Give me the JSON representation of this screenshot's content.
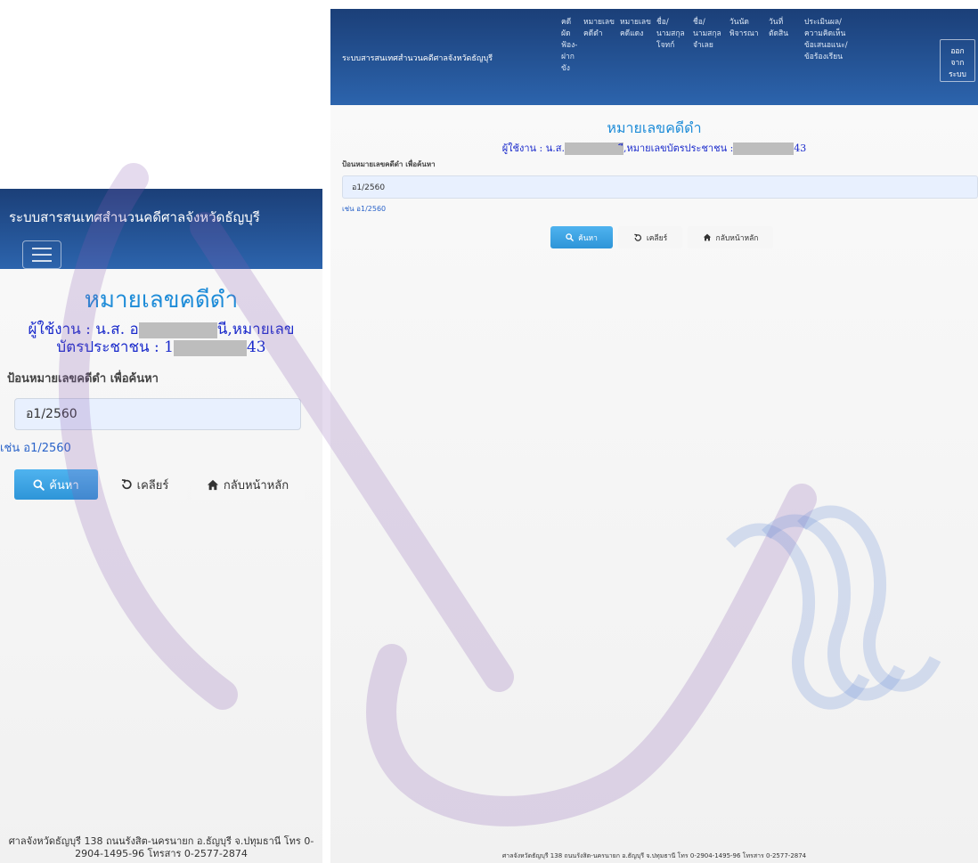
{
  "app": {
    "brand": "ระบบสารสนเทศสำนวนคดีศาลจังหวัดธัญบุรี"
  },
  "nav": {
    "items": [
      {
        "lines": [
          "คดี",
          "ผัด",
          "ฟ้อง-",
          "ฝาก",
          "ขัง"
        ]
      },
      {
        "lines": [
          "หมายเลข",
          "คดีดำ"
        ]
      },
      {
        "lines": [
          "หมายเลข",
          "คดีแดง"
        ]
      },
      {
        "lines": [
          "ชื่อ/",
          "นามสกุล",
          "โจทก์"
        ]
      },
      {
        "lines": [
          "ชื่อ/",
          "นามสกุล",
          "จำเลย"
        ]
      },
      {
        "lines": [
          "วันนัด",
          "พิจารณา"
        ]
      },
      {
        "lines": [
          "วันที่",
          "ตัดสิน"
        ]
      },
      {
        "lines": [
          "ประเมินผล/",
          "ความคิดเห็น",
          "ข้อเสนอแนะ/",
          "ข้อร้องเรียน"
        ]
      }
    ],
    "logout": [
      "ออก",
      "จาก",
      "ระบบ"
    ]
  },
  "page": {
    "title": "หมายเลขคดีดำ",
    "user_prefix": "ผู้ใช้งาน : น.ส.",
    "mobile_user_prefix": "ผู้ใช้งาน : น.ส. อ",
    "user_name_suffix": "นี,หมายเลข",
    "desktop_user_mid": "ี,หมายเลขบัตรประชาชน :",
    "id_label": "บัตรประชาชน : 1",
    "id_suffix": "43"
  },
  "search": {
    "label": "ป้อนหมายเลขคดีดำ เพื่อค้นหา",
    "value": "อ1/2560",
    "hint": "เช่น อ1/2560"
  },
  "buttons": {
    "search": "ค้นหา",
    "clear": "เคลียร์",
    "home": "กลับหน้าหลัก"
  },
  "footer": {
    "mobile_line1": "ศาลจังหวัดธัญบุรี 138 ถนนรังสิต-นครนายก อ.ธัญบุรี จ.ปทุมธานี โทร 0-",
    "mobile_line2": "2904-1495-96 โทรสาร 0-2577-2874",
    "desktop": "ศาลจังหวัดธัญบุรี 138 ถนนรังสิต-นครนายก อ.ธัญบุรี จ.ปทุมธานี โทร 0-2904-1495-96 โทรสาร 0-2577-2874"
  },
  "colors": {
    "header_dark": "#1b3f78",
    "header_light": "#2c64ad",
    "title_blue": "#1e8cd8",
    "user_blue": "#1a2acb",
    "primary_button": "#2e95d8",
    "watermark": "#8a5db0"
  },
  "icons": {
    "search": "search-icon",
    "clear": "undo-icon",
    "home": "home-icon",
    "menu": "hamburger-icon"
  }
}
